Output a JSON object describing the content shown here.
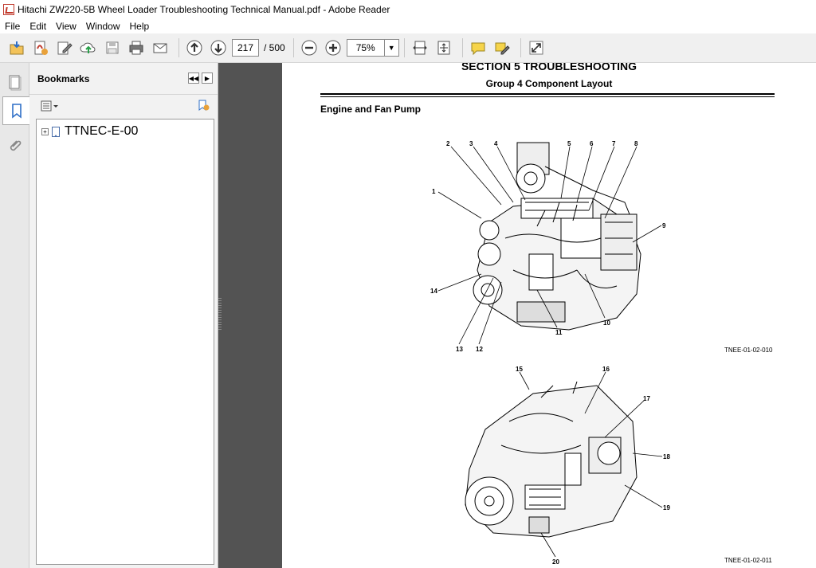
{
  "window": {
    "title": "Hitachi ZW220-5B Wheel Loader Troubleshooting Technical Manual.pdf - Adobe Reader",
    "app_icon": "adobe-reader-icon"
  },
  "menu": [
    "File",
    "Edit",
    "View",
    "Window",
    "Help"
  ],
  "toolbar": {
    "page_current": "217",
    "page_total": "/ 500",
    "zoom": "75%"
  },
  "bookmarks": {
    "header": "Bookmarks",
    "items": [
      {
        "label": "TTNEC-E-00"
      }
    ]
  },
  "document": {
    "section_title": "SECTION 5 TROUBLESHOOTING",
    "group_title": "Group 4 Component Layout",
    "subtitle": "Engine and Fan Pump",
    "figure1": {
      "code": "TNEE-01-02-010",
      "callouts": [
        "1",
        "2",
        "3",
        "4",
        "5",
        "6",
        "7",
        "8",
        "9",
        "10",
        "11",
        "12",
        "13",
        "14"
      ]
    },
    "figure2": {
      "code": "TNEE-01-02-011",
      "callouts": [
        "15",
        "16",
        "17",
        "18",
        "19",
        "20"
      ]
    }
  }
}
